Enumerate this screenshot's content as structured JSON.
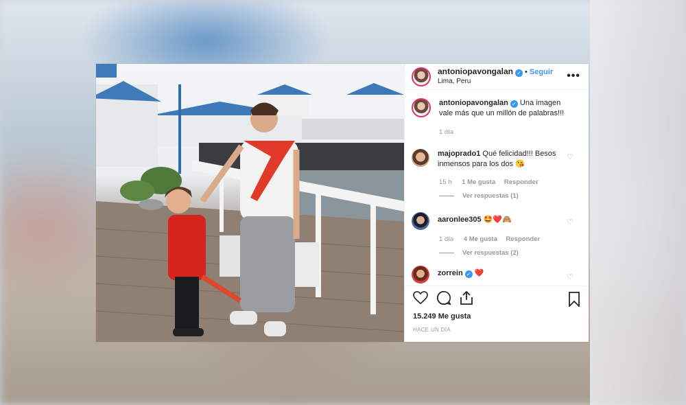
{
  "post": {
    "author": "antoniopavongalan",
    "separator": "•",
    "follow_label": "Seguir",
    "location": "Lima, Peru",
    "more_label": "•••",
    "caption": {
      "user": "antoniopavongalan",
      "text": "Una imagen vale más que un millón de palabras!!!",
      "time": "1 día"
    },
    "comments": [
      {
        "user": "majoprado1",
        "text": "Qué felicidad!!! Besos inmensos para los dos 😘",
        "time": "15 h",
        "likes": "1 Me gusta",
        "reply_label": "Responder",
        "view_replies": "Ver respuestas (1)"
      },
      {
        "user": "aaronlee305",
        "text": "🤩❤️🙈",
        "time": "1 día",
        "likes": "4 Me gusta",
        "reply_label": "Responder",
        "view_replies": "Ver respuestas (2)"
      },
      {
        "user": "zorrein",
        "text": "❤️"
      }
    ],
    "likes_count": "15.249 Me gusta",
    "date": "HACE UN DÍA"
  },
  "icons": {
    "like": "heart-icon",
    "comment": "comment-icon",
    "share": "share-icon",
    "save": "bookmark-icon",
    "verified": "verified-badge-icon"
  },
  "colors": {
    "link": "#3897f0",
    "avatar_ring": "#e1306c",
    "text": "#262626",
    "muted": "#999999"
  }
}
